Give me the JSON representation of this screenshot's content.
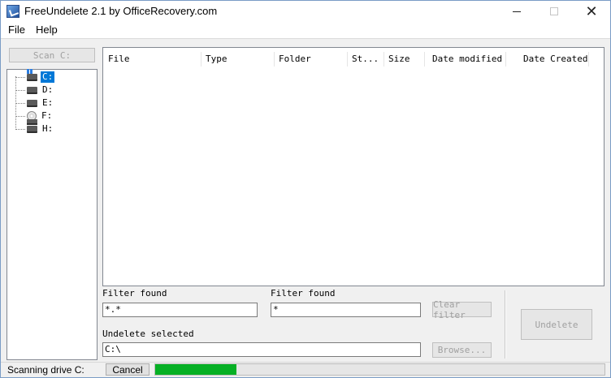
{
  "window": {
    "title": "FreeUndelete 2.1 by OfficeRecovery.com"
  },
  "menu": {
    "items": [
      "File",
      "Help"
    ]
  },
  "scan_button": "Scan C:",
  "drives": [
    {
      "label": "C:",
      "selected": true,
      "icon": "system-drive-icon"
    },
    {
      "label": "D:",
      "selected": false,
      "icon": "drive-icon"
    },
    {
      "label": "E:",
      "selected": false,
      "icon": "drive-icon"
    },
    {
      "label": "F:",
      "selected": false,
      "icon": "cd-drive-icon"
    },
    {
      "label": "H:",
      "selected": false,
      "icon": "drive-icon"
    }
  ],
  "file_list": {
    "columns": [
      "File",
      "Type",
      "Folder",
      "St...",
      "Size",
      "Date modified",
      "Date Created"
    ]
  },
  "filter": {
    "label1": "Filter found",
    "value1": "*.*",
    "label2": "Filter found",
    "value2": "*",
    "clear_button": "Clear filter"
  },
  "undelete": {
    "label": "Undelete selected",
    "path": "C:\\",
    "browse_button": "Browse...",
    "undelete_button": "Undelete"
  },
  "status": {
    "text": "Scanning drive C:",
    "cancel_button": "Cancel",
    "progress": 0.18,
    "progress_color": "#06b025"
  }
}
